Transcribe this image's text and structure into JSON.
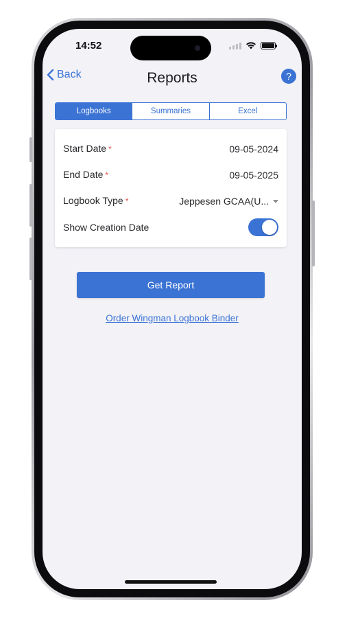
{
  "status_bar": {
    "time": "14:52"
  },
  "nav": {
    "back_label": "Back",
    "title": "Reports",
    "help_label": "?"
  },
  "tabs": [
    {
      "label": "Logbooks",
      "active": true
    },
    {
      "label": "Summaries",
      "active": false
    },
    {
      "label": "Excel",
      "active": false
    }
  ],
  "form": {
    "start_date": {
      "label": "Start Date",
      "required": "*",
      "value": "09-05-2024"
    },
    "end_date": {
      "label": "End Date",
      "required": "*",
      "value": "09-05-2025"
    },
    "logbook_type": {
      "label": "Logbook Type",
      "required": "*",
      "value": "Jeppesen GCAA(U..."
    },
    "show_creation_date": {
      "label": "Show Creation Date",
      "enabled": true
    }
  },
  "actions": {
    "get_report_label": "Get Report",
    "order_binder_label": "Order Wingman Logbook Binder"
  },
  "colors": {
    "accent": "#3b73d4",
    "background": "#f2f2f7",
    "required": "#e0504a"
  },
  "icons": [
    "chevron-left-icon",
    "help-icon",
    "wifi-icon",
    "signal-icon",
    "battery-icon",
    "dropdown-arrow-icon"
  ]
}
